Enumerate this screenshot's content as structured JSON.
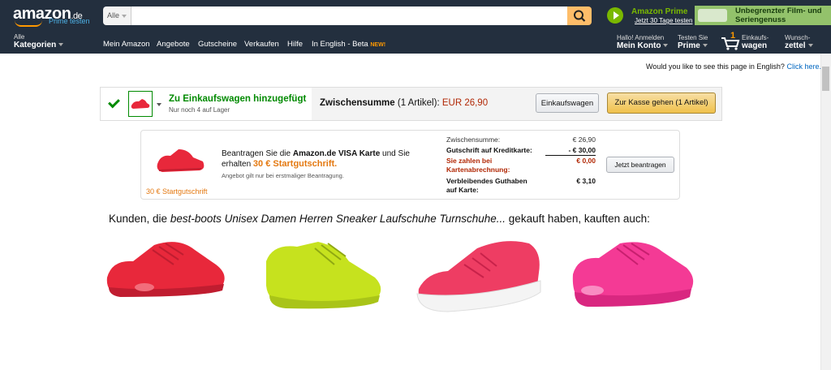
{
  "header": {
    "logo_text": "amazon",
    "logo_tld": ".de",
    "logo_sub": "Prime testen",
    "search": {
      "category": "Alle",
      "value": ""
    },
    "prime_promo": {
      "title": "Amazon Prime",
      "subtitle": "Jetzt 30 Tage testen"
    },
    "banner": "Unbegrenzter Film- und Seriengenuss"
  },
  "nav": {
    "categories_small": "Alle",
    "categories_bold": "Kategorien",
    "links": [
      "Mein Amazon",
      "Angebote",
      "Gutscheine",
      "Verkaufen",
      "Hilfe",
      "In English - Beta"
    ],
    "new_badge": "NEW!",
    "account_small": "Hallo! Anmelden",
    "account_bold": "Mein Konto",
    "prime_small": "Testen Sie",
    "prime_bold": "Prime",
    "cart_count": "1",
    "cart_small": "Einkaufs-",
    "cart_bold": "wagen",
    "wishlist_small": "Wunsch-",
    "wishlist_bold": "zettel"
  },
  "english_prompt": {
    "question": "Would you like to see this page in English?",
    "link": "Click here."
  },
  "added": {
    "title": "Zu Einkaufswagen hinzugefügt",
    "stock": "Nur noch 4 auf Lager",
    "subtotal_label": "Zwischensumme",
    "subtotal_count": "(1 Artikel):",
    "subtotal_price": "EUR 26,90",
    "cart_button": "Einkaufswagen",
    "checkout_button": "Zur Kasse gehen (1 Artikel)"
  },
  "visa": {
    "text_pre": "Beantragen Sie die ",
    "text_brand": "Amazon.de VISA Karte",
    "text_mid": " und Sie erhalten ",
    "text_bonus": "30 € Startgutschrift.",
    "note": "Angebot gilt nur bei erstmaliger Beantragung.",
    "credit_label": "30 € Startgutschrift",
    "rows": [
      {
        "label": "Zwischensumme:",
        "value": "€ 26,90"
      },
      {
        "label": "Gutschrift auf Kreditkarte:",
        "value": "- € 30,00"
      },
      {
        "label": "Sie zahlen bei Kartenabrechnung:",
        "value": "€ 0,00"
      },
      {
        "label": "Verbleibendes Guthaben auf Karte:",
        "value": "€ 3,10"
      }
    ],
    "apply_button": "Jetzt beantragen"
  },
  "recommendations": {
    "heading_pre": "Kunden, die ",
    "heading_product": "best-boots Unisex Damen Herren Sneaker Laufschuhe Turnschuhe...",
    "heading_post": " gekauft haben, kauften auch:",
    "products": [
      {
        "color": "red",
        "hex": "#e8283b"
      },
      {
        "color": "neon-yellow",
        "hex": "#c6e21e"
      },
      {
        "color": "pink",
        "hex": "#ee3d63"
      },
      {
        "color": "hot-pink",
        "hex": "#f43a95"
      }
    ]
  },
  "colors": {
    "nav_bg": "#232f3e",
    "accent": "#ff9900",
    "price": "#b12704",
    "success": "#008a00",
    "link": "#0066c0"
  }
}
